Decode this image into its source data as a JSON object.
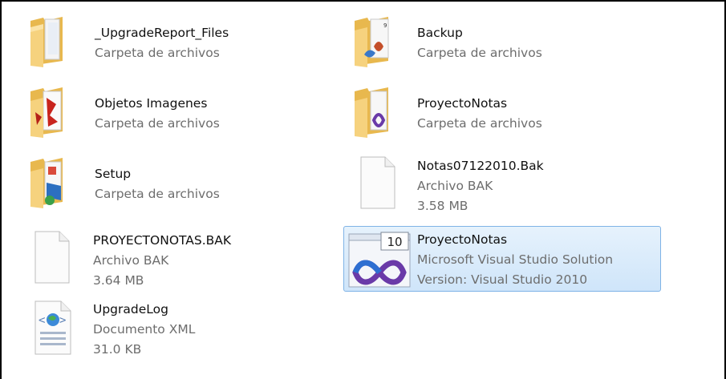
{
  "items": [
    {
      "name": "_UpgradeReport_Files",
      "type": "Carpeta de archivos",
      "icon": "folder-icon"
    },
    {
      "name": "Backup",
      "type": "Carpeta de archivos",
      "icon": "folder-icon"
    },
    {
      "name": "Objetos Imagenes",
      "type": "Carpeta de archivos",
      "icon": "folder-icon"
    },
    {
      "name": "ProyectoNotas",
      "type": "Carpeta de archivos",
      "icon": "folder-icon"
    },
    {
      "name": "Setup",
      "type": "Carpeta de archivos",
      "icon": "folder-icon"
    },
    {
      "name": "Notas07122010.Bak",
      "type": "Archivo BAK",
      "size": "3.58 MB",
      "icon": "blank-file-icon"
    },
    {
      "name": "PROYECTONOTAS.BAK",
      "type": "Archivo BAK",
      "size": "3.64 MB",
      "icon": "blank-file-icon"
    },
    {
      "name": "ProyectoNotas",
      "type": "Microsoft Visual Studio Solution",
      "size": "Version: Visual Studio 2010",
      "icon": "visual-studio-solution-icon",
      "badge": "10",
      "selected": true
    },
    {
      "name": "UpgradeLog",
      "type": "Documento XML",
      "size": "31.0 KB",
      "icon": "xml-document-icon"
    }
  ],
  "colors": {
    "selection_bg": "#cfe5fa",
    "selection_border": "#7fb3e6",
    "secondary_text": "#6d6d6d",
    "folder": "#f2c66b"
  }
}
